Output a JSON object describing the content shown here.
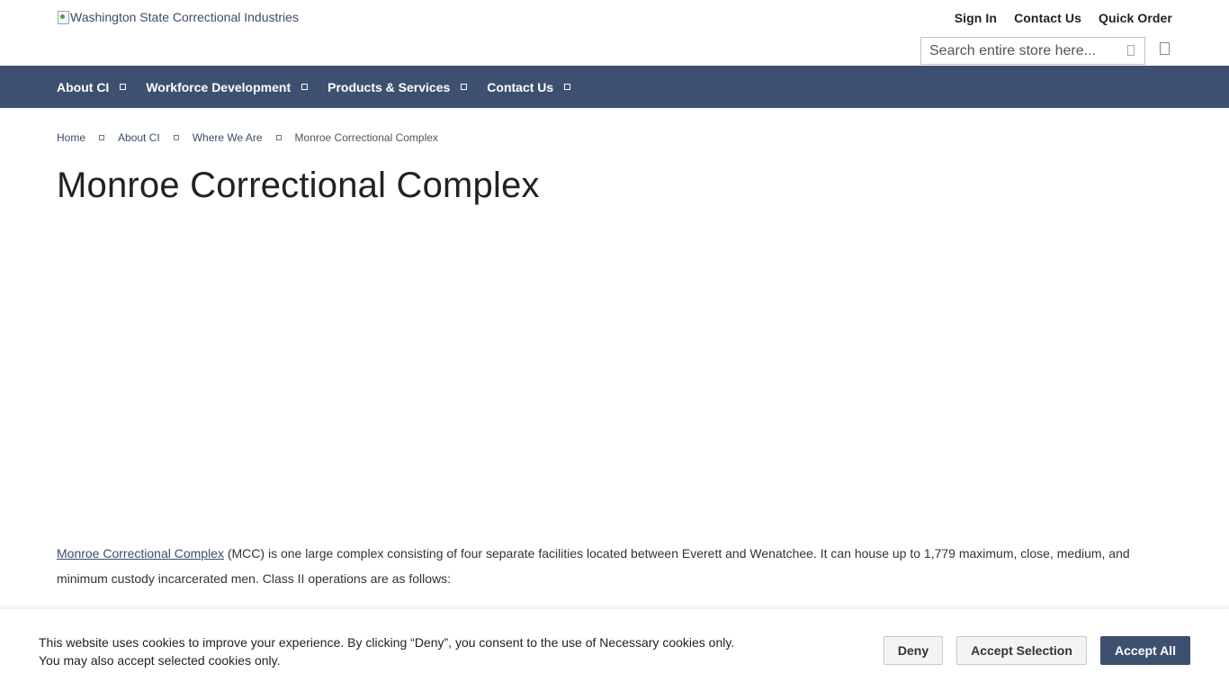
{
  "header": {
    "logo_alt": "Washington State Correctional Industries",
    "links": {
      "sign_in": "Sign In",
      "contact_us": "Contact Us",
      "quick_order": "Quick Order"
    },
    "search": {
      "placeholder": "Search entire store here..."
    }
  },
  "nav": {
    "items": [
      {
        "label": "About CI"
      },
      {
        "label": "Workforce Development"
      },
      {
        "label": "Products & Services"
      },
      {
        "label": "Contact Us"
      }
    ],
    "background": "#3e5070"
  },
  "breadcrumb": {
    "home": "Home",
    "about": "About CI",
    "where": "Where We Are",
    "current": "Monroe Correctional Complex"
  },
  "page": {
    "title": "Monroe Correctional Complex",
    "intro_link": "Monroe Correctional Complex",
    "intro_text": " (MCC) is one large complex consisting of four separate facilities located between Everett and Wenatchee. It can house up to 1,779 maximum, close, medium, and minimum custody incarcerated men. Class II operations are as follows:"
  },
  "cookie": {
    "line1": "This website uses cookies to improve your experience. By clicking “Deny”, you consent to the use of Necessary cookies only.",
    "line2": "You may also accept selected cookies only.",
    "deny": "Deny",
    "accept_selection": "Accept Selection",
    "accept_all": "Accept All"
  }
}
